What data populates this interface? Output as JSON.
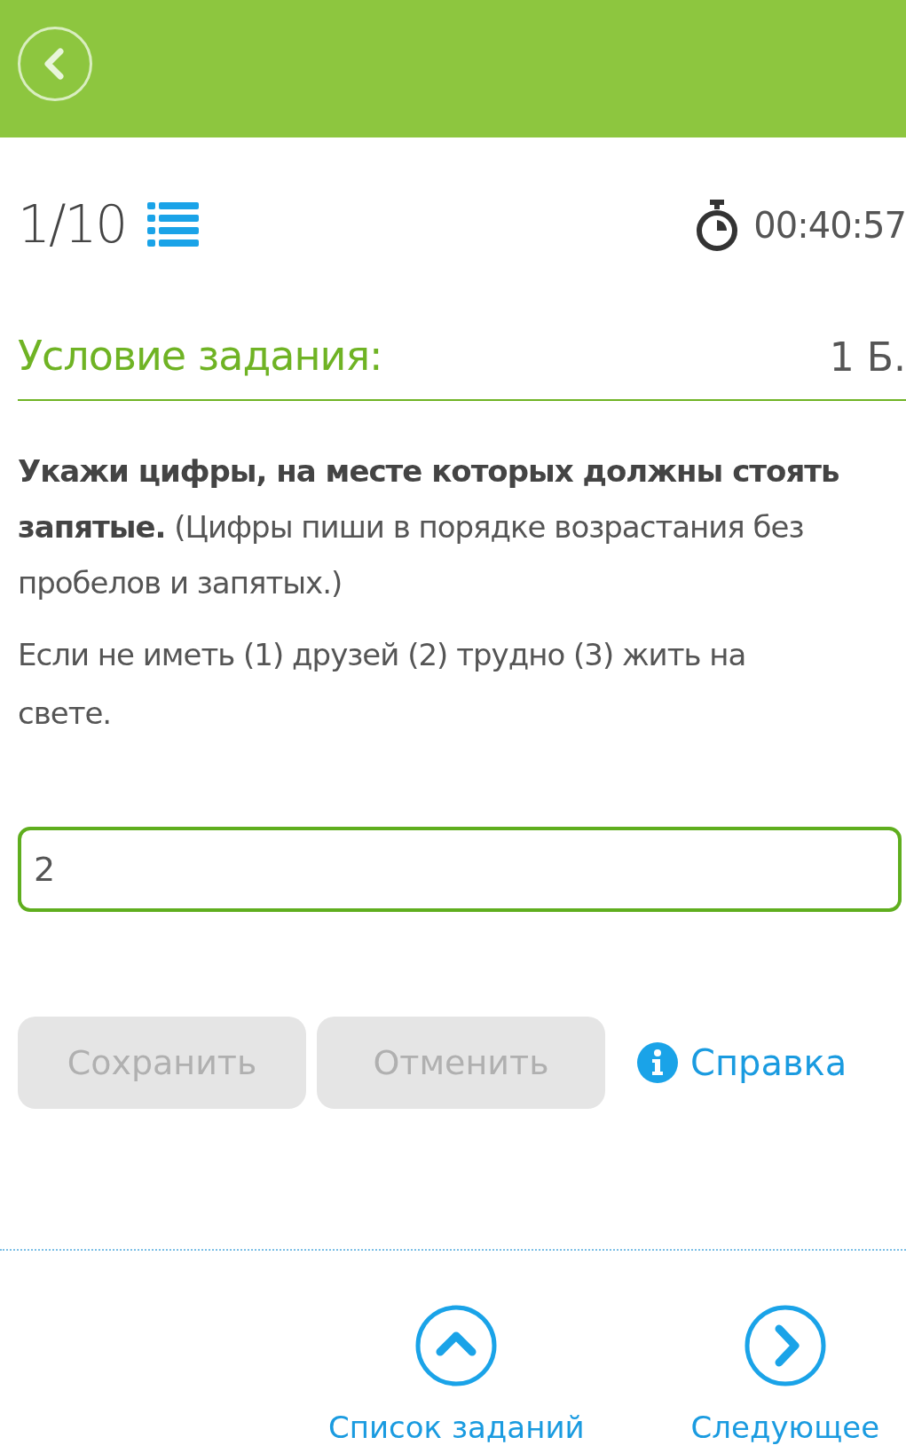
{
  "header": {
    "back_button": true
  },
  "progress": {
    "counter": "1/10",
    "timer": "00:40:57"
  },
  "task": {
    "title": "Условие задания:",
    "points": "1 Б.",
    "instruction": "**Укажи цифры, на месте которых должны стоять запятые.** (Цифры пиши в порядке возрастания без пробелов и запятых.)",
    "sentence": "Если не иметь (1) друзей (2) трудно (3) жить на свете."
  },
  "answer": {
    "value": "2"
  },
  "buttons": [
    {
      "label": "Сохранить",
      "kind": "action",
      "disabled": true
    },
    {
      "label": "Отменить",
      "kind": "action",
      "disabled": true
    },
    {
      "label": "Справка",
      "kind": "help",
      "disabled": false
    }
  ],
  "footer": [
    {
      "label": "Список заданий",
      "kind": "up"
    },
    {
      "label": "Следующее",
      "kind": "next"
    }
  ]
}
